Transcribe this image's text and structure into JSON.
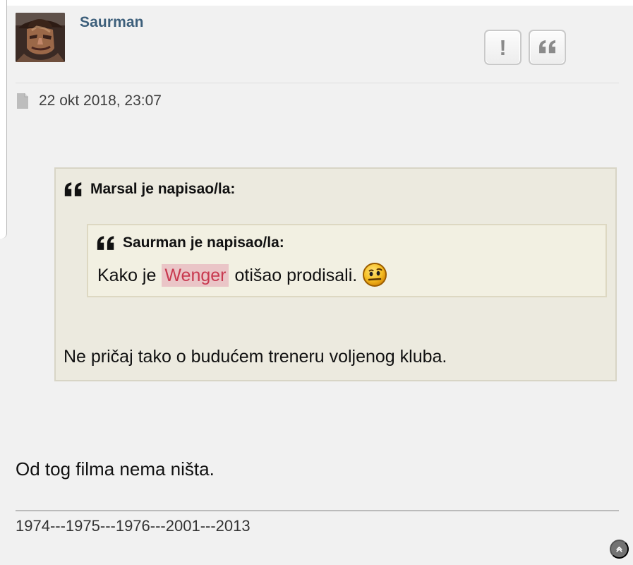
{
  "post": {
    "author": "Saurman",
    "date": "22 okt 2018, 23:07",
    "actions": {
      "report_label": "!",
      "report_icon": "exclamation-icon",
      "quote_icon": "quote-icon"
    },
    "quote": {
      "author_line": "Marsal je napisao/la:",
      "nested_quote": {
        "author_line": "Saurman je napisao/la:",
        "text_before": "Kako je",
        "highlighted_text": "Wenger",
        "text_after": "otišao prodisali.",
        "emoji": "thinking-face-emoji"
      },
      "reply": "Ne pričaj tako o budućem treneru voljenog kluba."
    },
    "body": "Od tog filma nema ništa.",
    "signature": "1974---1975---1976---2001---2013"
  },
  "controls": {
    "scroll_top_icon": "chevron-up-icon"
  },
  "colors": {
    "author": "#3d5f7b",
    "quote_background": "#eceadf",
    "nested_quote_background": "#f2f0e2",
    "highlight_background": "#eac5c7",
    "highlight_text": "#c8394f",
    "page_background": "#f1f1f1"
  }
}
